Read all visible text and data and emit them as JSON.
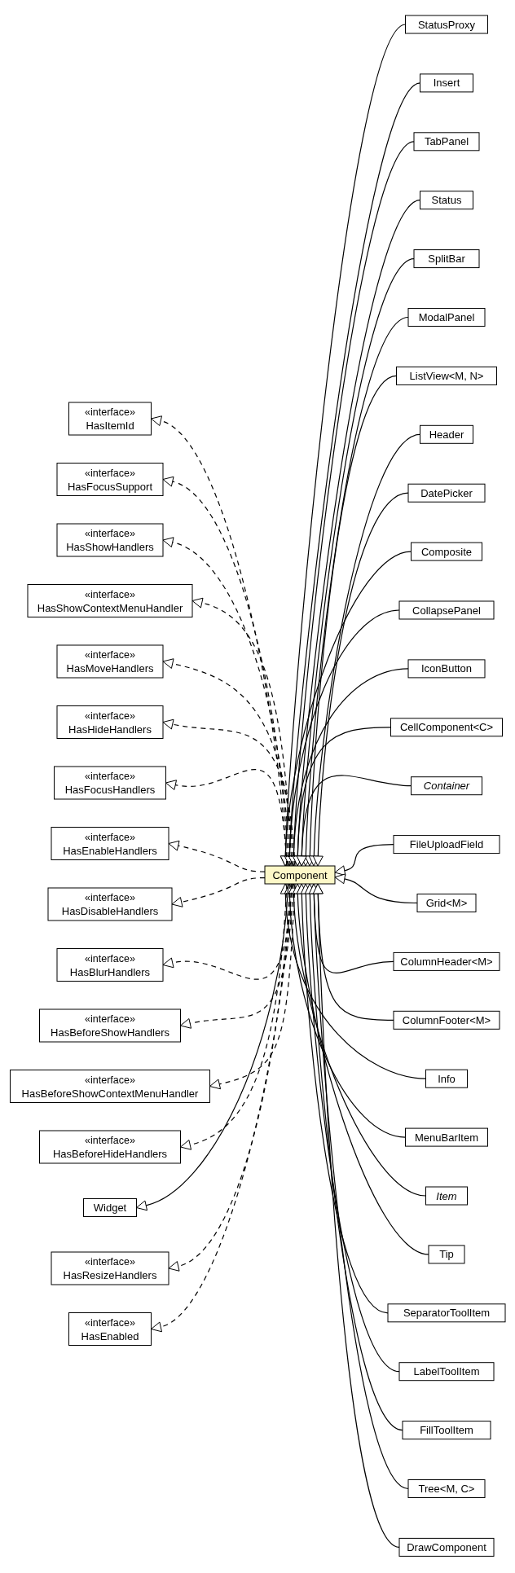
{
  "diagram": {
    "center_class": {
      "name": "Component"
    },
    "supertypes": [
      {
        "kind": "interface",
        "stereotype": "«interface»",
        "name": "HasItemId"
      },
      {
        "kind": "interface",
        "stereotype": "«interface»",
        "name": "HasFocusSupport"
      },
      {
        "kind": "interface",
        "stereotype": "«interface»",
        "name": "HasShowHandlers"
      },
      {
        "kind": "interface",
        "stereotype": "«interface»",
        "name": "HasShowContextMenuHandler"
      },
      {
        "kind": "interface",
        "stereotype": "«interface»",
        "name": "HasMoveHandlers"
      },
      {
        "kind": "interface",
        "stereotype": "«interface»",
        "name": "HasHideHandlers"
      },
      {
        "kind": "interface",
        "stereotype": "«interface»",
        "name": "HasFocusHandlers"
      },
      {
        "kind": "interface",
        "stereotype": "«interface»",
        "name": "HasEnableHandlers"
      },
      {
        "kind": "interface",
        "stereotype": "«interface»",
        "name": "HasDisableHandlers"
      },
      {
        "kind": "interface",
        "stereotype": "«interface»",
        "name": "HasBlurHandlers"
      },
      {
        "kind": "interface",
        "stereotype": "«interface»",
        "name": "HasBeforeShowHandlers"
      },
      {
        "kind": "interface",
        "stereotype": "«interface»",
        "name": "HasBeforeShowContextMenuHandler"
      },
      {
        "kind": "interface",
        "stereotype": "«interface»",
        "name": "HasBeforeHideHandlers"
      },
      {
        "kind": "class",
        "name": "Widget"
      },
      {
        "kind": "interface",
        "stereotype": "«interface»",
        "name": "HasResizeHandlers"
      },
      {
        "kind": "interface",
        "stereotype": "«interface»",
        "name": "HasEnabled"
      }
    ],
    "subclasses": [
      {
        "name": "StatusProxy",
        "abstract": false
      },
      {
        "name": "Insert",
        "abstract": false
      },
      {
        "name": "TabPanel",
        "abstract": false
      },
      {
        "name": "Status",
        "abstract": false
      },
      {
        "name": "SplitBar",
        "abstract": false
      },
      {
        "name": "ModalPanel",
        "abstract": false
      },
      {
        "name": "ListView<M, N>",
        "abstract": false
      },
      {
        "name": "Header",
        "abstract": false
      },
      {
        "name": "DatePicker",
        "abstract": false
      },
      {
        "name": "Composite",
        "abstract": false
      },
      {
        "name": "CollapsePanel",
        "abstract": false
      },
      {
        "name": "IconButton",
        "abstract": false
      },
      {
        "name": "CellComponent<C>",
        "abstract": false
      },
      {
        "name": "Container",
        "abstract": true
      },
      {
        "name": "FileUploadField",
        "abstract": false
      },
      {
        "name": "Grid<M>",
        "abstract": false
      },
      {
        "name": "ColumnHeader<M>",
        "abstract": false
      },
      {
        "name": "ColumnFooter<M>",
        "abstract": false
      },
      {
        "name": "Info",
        "abstract": false
      },
      {
        "name": "MenuBarItem",
        "abstract": false
      },
      {
        "name": "Item",
        "abstract": true
      },
      {
        "name": "Tip",
        "abstract": false
      },
      {
        "name": "SeparatorToolItem",
        "abstract": false
      },
      {
        "name": "LabelToolItem",
        "abstract": false
      },
      {
        "name": "FillToolItem",
        "abstract": false
      },
      {
        "name": "Tree<M, C>",
        "abstract": false
      },
      {
        "name": "DrawComponent",
        "abstract": false
      }
    ]
  }
}
